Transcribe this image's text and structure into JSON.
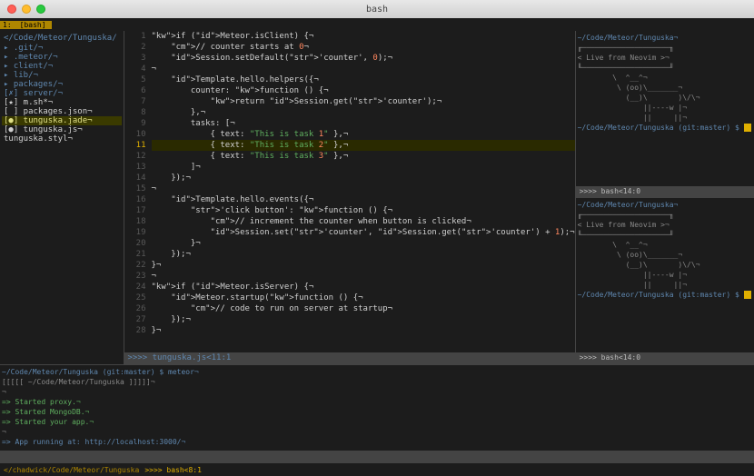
{
  "titlebar": {
    "title": "bash"
  },
  "tabbar": {
    "num": "1:",
    "label": "[bash]"
  },
  "filetree": {
    "header": "</Code/Meteor/Tunguska/",
    "items": [
      {
        "icon": "▸",
        "label": ".git/¬",
        "dir": true
      },
      {
        "icon": "▸",
        "label": ".meteor/¬",
        "dir": true
      },
      {
        "icon": "▸",
        "label": "client/¬",
        "dir": true
      },
      {
        "icon": "▸",
        "label": "lib/¬",
        "dir": true
      },
      {
        "icon": "▸",
        "label": "packages/¬",
        "dir": true
      },
      {
        "icon": "[✗]",
        "label": "server/¬",
        "dir": true
      },
      {
        "icon": "[★]",
        "label": "m.sh*¬",
        "dir": false
      },
      {
        "icon": "[ ]",
        "label": "packages.json¬",
        "dir": false
      },
      {
        "icon": "[●]",
        "label": "tunguska.jade¬",
        "dir": false,
        "hl": true
      },
      {
        "icon": "[●]",
        "label": "tunguska.js¬",
        "dir": false
      },
      {
        "icon": " ",
        "label": "tunguska.styl¬",
        "dir": false
      }
    ]
  },
  "editor": {
    "status_left": ">>>> tunguska.js<11:1",
    "gutter_current": 11,
    "lines": [
      {
        "n": 1,
        "t": "if (Meteor.isClient) {¬"
      },
      {
        "n": 2,
        "t": "    // counter starts at 0¬"
      },
      {
        "n": 3,
        "t": "    Session.setDefault('counter', 0);¬"
      },
      {
        "n": 4,
        "t": "¬"
      },
      {
        "n": 5,
        "t": "    Template.hello.helpers({¬"
      },
      {
        "n": 6,
        "t": "        counter: function () {¬"
      },
      {
        "n": 7,
        "t": "            return Session.get('counter');¬"
      },
      {
        "n": 8,
        "t": "        },¬"
      },
      {
        "n": 9,
        "t": "        tasks: [¬"
      },
      {
        "n": 10,
        "t": "            { text: \"This is task 1\" },¬"
      },
      {
        "n": 11,
        "t": "            { text: \"This is task 2\" },¬",
        "cur": true
      },
      {
        "n": 12,
        "t": "            { text: \"This is task 3\" },¬"
      },
      {
        "n": 13,
        "t": "        ]¬"
      },
      {
        "n": 14,
        "t": "    });¬"
      },
      {
        "n": 15,
        "t": "¬"
      },
      {
        "n": 16,
        "t": "    Template.hello.events({¬"
      },
      {
        "n": 17,
        "t": "        'click button': function () {¬"
      },
      {
        "n": 18,
        "t": "            // increment the counter when button is clicked¬"
      },
      {
        "n": 19,
        "t": "            Session.set('counter', Session.get('counter') + 1);¬"
      },
      {
        "n": 20,
        "t": "        }¬"
      },
      {
        "n": 21,
        "t": "    });¬"
      },
      {
        "n": 22,
        "t": "}¬"
      },
      {
        "n": 23,
        "t": "¬"
      },
      {
        "n": 24,
        "t": "if (Meteor.isServer) {¬"
      },
      {
        "n": 25,
        "t": "    Meteor.startup(function () {¬"
      },
      {
        "n": 26,
        "t": "        // code to run on server at startup¬"
      },
      {
        "n": 27,
        "t": "    });¬"
      },
      {
        "n": 28,
        "t": "}¬"
      }
    ]
  },
  "terminals": {
    "pane1": {
      "path": "~/Code/Meteor/Tunguska¬",
      "banner": [
        "╓────────────────────╖",
        "< Live from Neovim >¬",
        "╙────────────────────╜",
        "        \\  ^__^¬",
        "         \\ (oo)\\_______¬",
        "           (__)\\       )\\/\\¬",
        "               ||----w |¬",
        "               ||     ||¬"
      ],
      "prompt": "~/Code/Meteor/Tunguska (git:master) $",
      "status": ">>>> bash<14:0"
    },
    "pane2": {
      "path": "~/Code/Meteor/Tunguska¬",
      "banner": [
        "╓────────────────────╖",
        "< Live from Neovim >¬",
        "╙────────────────────╜",
        "        \\  ^__^¬",
        "         \\ (oo)\\_______¬",
        "           (__)\\       )\\/\\¬",
        "               ||----w |¬",
        "               ||     ||¬"
      ],
      "prompt": "~/Code/Meteor/Tunguska (git:master) $",
      "status": ">>>> bash<14:0"
    }
  },
  "bottom": {
    "l1": "~/Code/Meteor/Tunguska (git:master) $ meteor¬",
    "l2": "[[[[[ ~/Code/Meteor/Tunguska ]]]]]¬",
    "l3": "¬",
    "l4": "=> Started proxy.¬",
    "l5": "=> Started MongoDB.¬",
    "l6": "=> Started your app.¬",
    "l7": "¬",
    "l8": "=> App running at: http://localhost:3000/¬",
    "status": ""
  },
  "statusbar": {
    "path": "</chadwick/Code/Meteor/Tunguska",
    "pos": ">>>> bash<8:1"
  }
}
